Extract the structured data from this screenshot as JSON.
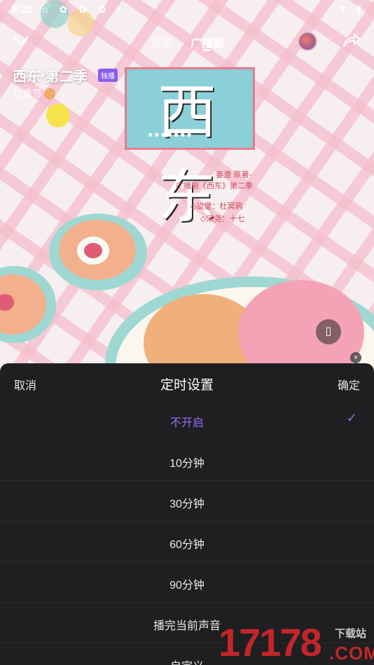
{
  "status_bar": {
    "time": "5:22",
    "left_icons": "⌂ ✿ ✿ ✿ •",
    "right_icons": "▼ ▮"
  },
  "nav": {
    "back_icon": "chevron-down-icon",
    "tabs": [
      {
        "label": "详情",
        "active": false
      },
      {
        "label": "广播剧",
        "active": true
      }
    ],
    "share_icon": "share-icon"
  },
  "show": {
    "title": "西东·第二季",
    "badge": "独播",
    "subtitle": "儿童节"
  },
  "poster": {
    "calligraphy": "西东",
    "dots": "●●●●●●●",
    "credits": [
      "姜澄 原著-",
      "广播剧《西东》第二季",
      "◇旋堡：杜冥鸦",
      "◇宋尧：十七"
    ]
  },
  "sheet": {
    "cancel_label": "取消",
    "title": "定时设置",
    "confirm_label": "确定",
    "options": [
      {
        "label": "不开启",
        "selected": true
      },
      {
        "label": "10分钟",
        "selected": false
      },
      {
        "label": "30分钟",
        "selected": false
      },
      {
        "label": "60分钟",
        "selected": false
      },
      {
        "label": "90分钟",
        "selected": false
      },
      {
        "label": "播完当前声音",
        "selected": false
      },
      {
        "label": "自定义",
        "selected": false
      }
    ],
    "check_glyph": "✓",
    "accent_color": "#9a6df4"
  },
  "watermark": {
    "number": "17178",
    "site_cn": "下载站",
    "domain": ".COM"
  }
}
